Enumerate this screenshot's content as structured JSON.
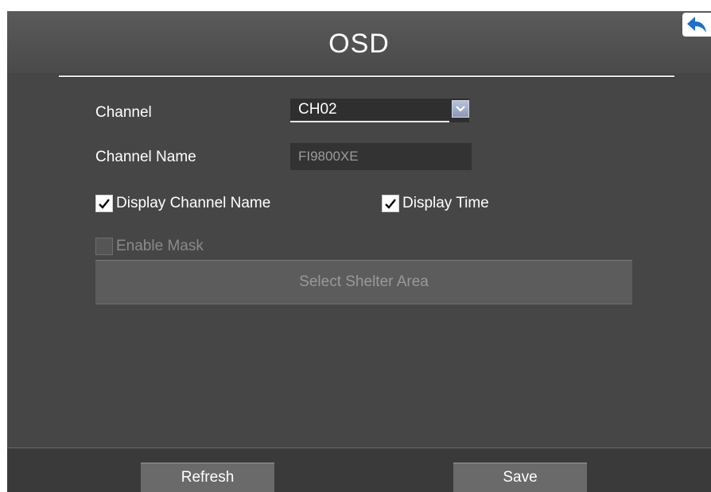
{
  "window": {
    "title": "OSD"
  },
  "form": {
    "channel_label": "Channel",
    "channel_value": "CH02",
    "channel_name_label": "Channel Name",
    "channel_name_value": "FI9800XE",
    "display_channel_name": {
      "label": "Display Channel Name",
      "checked": true
    },
    "display_time": {
      "label": "Display Time",
      "checked": true
    },
    "enable_mask": {
      "label": "Enable Mask",
      "checked": false,
      "disabled": true
    },
    "select_shelter_area_label": "Select Shelter Area"
  },
  "footer": {
    "refresh_label": "Refresh",
    "save_label": "Save"
  },
  "icons": {
    "back": "back-arrow-icon",
    "dropdown": "chevron-down-icon",
    "check": "check-icon"
  },
  "colors": {
    "panel_background": "#464646",
    "accent_back_arrow": "#1d6fd0",
    "dropdown_arrow": "#9aa6c0",
    "disabled_text": "#8a8a8a"
  }
}
